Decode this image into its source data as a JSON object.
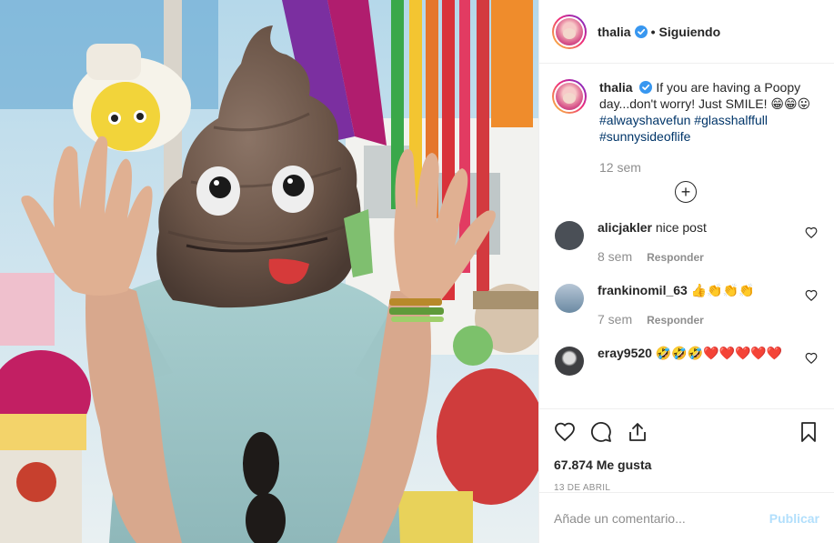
{
  "post": {
    "username": "thalia",
    "follow_status": "Siguiendo",
    "separator": "•"
  },
  "caption": {
    "username": "thalia",
    "text": "If you are having a Poopy day...don't worry! Just SMILE! 😁😁😛",
    "hashtags": [
      "#alwayshavefun",
      "#glasshalffull",
      "#sunnysideoflife"
    ],
    "time": "12 sem"
  },
  "load_more": "+",
  "comments": [
    {
      "username": "alicjakler",
      "text": "nice post",
      "time": "8 sem",
      "reply": "Responder",
      "avatar_color": "#4a4f56"
    },
    {
      "username": "frankinomil_63",
      "text": "👍👏👏👏",
      "time": "7 sem",
      "reply": "Responder",
      "avatar_color": "#8fa6b8"
    },
    {
      "username": "eray9520",
      "text": "🤣🤣🤣❤️❤️❤️❤️❤️",
      "time": "",
      "reply": "",
      "avatar_color": "#3e3f42"
    }
  ],
  "likes": "67.874 Me gusta",
  "date": "13 de abril",
  "add_comment": {
    "placeholder": "Añade un comentario...",
    "publish": "Publicar"
  },
  "colors": {
    "accent": "#003569",
    "muted": "#8e8e8e",
    "publish_disabled": "#b2dffc",
    "verified": "#3897f0"
  },
  "icons": [
    "verified-icon",
    "plus-circle-icon",
    "heart-icon",
    "comment-icon",
    "share-icon",
    "bookmark-icon"
  ]
}
